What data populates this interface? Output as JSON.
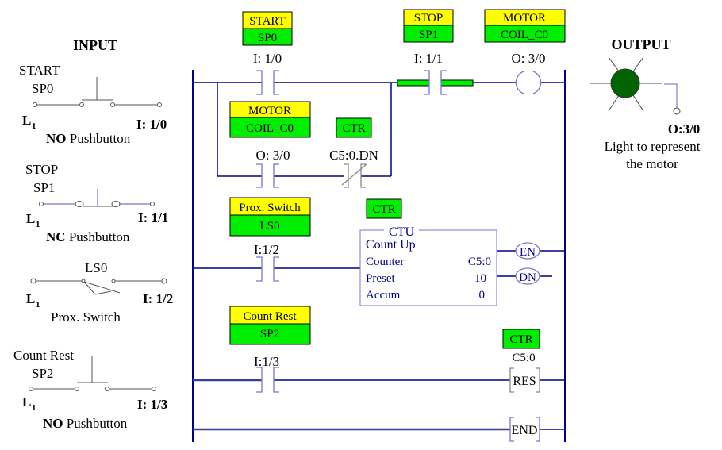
{
  "colors": {
    "tag_top": "#ffff00",
    "tag_bottom": "#00ee00",
    "ladder_wire": "#00008b",
    "lamp_on": "#006400"
  },
  "inputs": {
    "heading": "INPUT",
    "devices": [
      {
        "name": "START",
        "tag": "SP0",
        "left_terminal": "L",
        "left_sub": "1",
        "address": "I: 1/0",
        "type_bold": "NO",
        "type": " Pushbutton"
      },
      {
        "name": "STOP",
        "tag": "SP1",
        "left_terminal": "L",
        "left_sub": "1",
        "address": "I: 1/1",
        "type_bold": "NC",
        "type": " Pushbutton"
      },
      {
        "name": "",
        "tag": "LS0",
        "left_terminal": "L",
        "left_sub": "1",
        "address": "I: 1/2",
        "type_bold": "",
        "type": "Prox. Switch"
      },
      {
        "name": "Count Rest",
        "tag": "SP2",
        "left_terminal": "L",
        "left_sub": "1",
        "address": "I: 1/3",
        "type_bold": "NO",
        "type": " Pushbutton"
      }
    ]
  },
  "output": {
    "heading": "OUTPUT",
    "address": "O:3/0",
    "desc_line1": "Light to represent",
    "desc_line2": "the motor",
    "lamp_state": "on"
  },
  "ladder": {
    "rung1": {
      "start_contact": {
        "tag_top": "START",
        "tag_bottom": "SP0",
        "address": "I: 1/0",
        "type": "XIC"
      },
      "stop_contact": {
        "tag_top": "STOP",
        "tag_bottom": "SP1",
        "address": "I: 1/1",
        "type": "XIC",
        "energized": true
      },
      "coil": {
        "tag_top": "MOTOR",
        "tag_bottom": "COIL_C0",
        "address": "O: 3/0",
        "type": "OTE"
      },
      "seal_contact": {
        "tag_top": "MOTOR",
        "tag_bottom": "COIL_C0",
        "address": "O: 3/0",
        "type": "XIC"
      },
      "done_contact": {
        "tag": "CTR",
        "address": "C5:0.DN",
        "type": "XIO"
      }
    },
    "rung2": {
      "prox_contact": {
        "tag_top": "Prox. Switch",
        "tag_bottom": "LS0",
        "address": "I:1/2",
        "type": "XIC"
      },
      "counter": {
        "tag": "CTR",
        "title": "CTU",
        "subtitle": "Count Up",
        "rows": [
          {
            "label": "Counter",
            "value": "C5:0"
          },
          {
            "label": "Preset",
            "value": "10"
          },
          {
            "label": "Accum",
            "value": "0"
          }
        ],
        "outputs": [
          "EN",
          "DN"
        ]
      }
    },
    "rung3": {
      "reset_contact": {
        "tag_top": "Count Rest",
        "tag_bottom": "SP2",
        "address": "I:1/3",
        "type": "XIC"
      },
      "reset_instr": {
        "tag": "CTR",
        "address": "C5:0",
        "label": "RES"
      }
    },
    "rung4": {
      "end_label": "END"
    }
  }
}
